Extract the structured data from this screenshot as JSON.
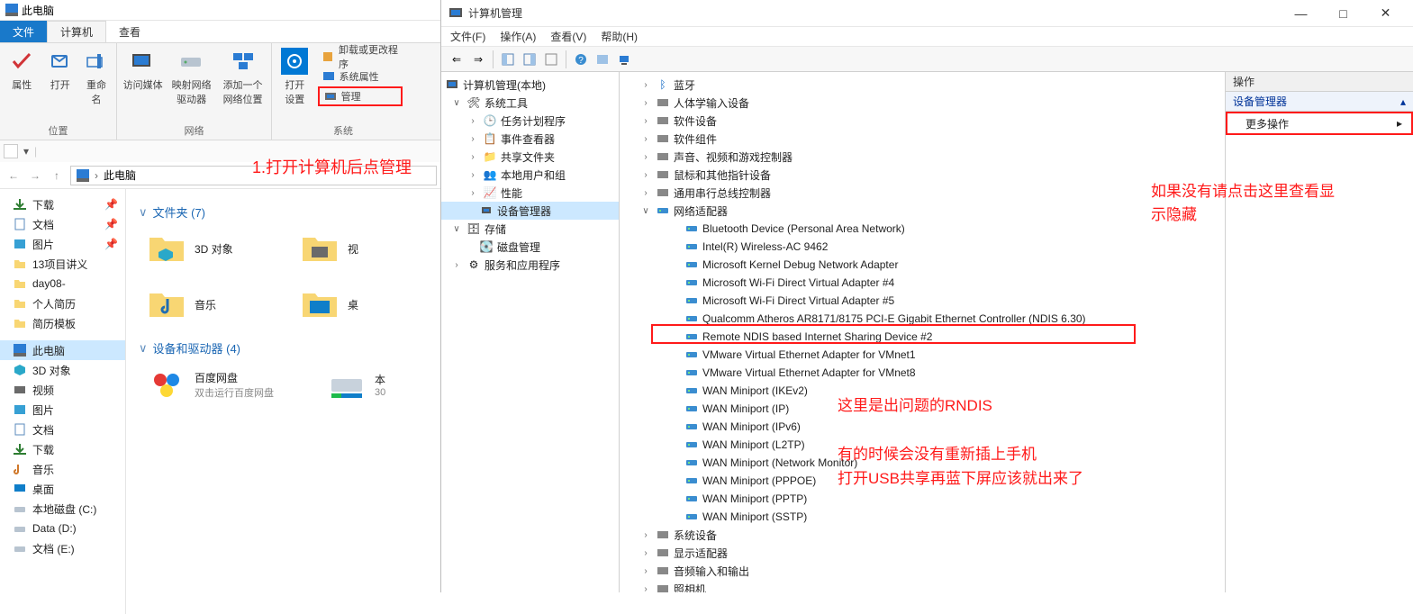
{
  "explorer": {
    "title": "此电脑",
    "tabs": {
      "file": "文件",
      "computer": "计算机",
      "view": "查看"
    },
    "ribbon": {
      "props": "属性",
      "open": "打开",
      "rename": "重命名",
      "access_media": "访问媒体",
      "map_drive": "映射网络\n驱动器",
      "add_loc": "添加一个\n网络位置",
      "open_settings": "打开\n设置",
      "uninstall": "卸载或更改程序",
      "sysprops": "系统属性",
      "manage": "管理",
      "grp_loc": "位置",
      "grp_net": "网络",
      "grp_sys": "系统"
    },
    "breadcrumb": {
      "root": "此电脑"
    },
    "sidebar": {
      "downloads": "下载",
      "docs": "文档",
      "pics": "图片",
      "proj13": "13项目讲义",
      "day08": "day08-",
      "resume": "个人简历",
      "tpl": "简历模板",
      "thispc": "此电脑",
      "obj3d": "3D 对象",
      "videos": "视频",
      "pics2": "图片",
      "docs2": "文档",
      "downloads2": "下载",
      "music": "音乐",
      "desktop": "桌面",
      "diskC": "本地磁盘 (C:)",
      "diskD": "Data (D:)",
      "diskE": "文档 (E:)"
    },
    "groups": {
      "folders_head": "文件夹 (7)",
      "devices_head": "设备和驱动器 (4)",
      "f_3d": "3D 对象",
      "f_video_partial": "视",
      "f_music": "音乐",
      "f_desktop_partial": "桌",
      "baidu": "百度网盘",
      "baidu_sub": "双击运行百度网盘",
      "local_partial": "本",
      "local_sub_partial": "30"
    },
    "annotation1": "1.打开计算机后点管理"
  },
  "cm": {
    "title": "计算机管理",
    "menu": {
      "file": "文件(F)",
      "action": "操作(A)",
      "view": "查看(V)",
      "help": "帮助(H)"
    },
    "left": {
      "root": "计算机管理(本地)",
      "systools": "系统工具",
      "tasks": "任务计划程序",
      "events": "事件查看器",
      "shared": "共享文件夹",
      "users": "本地用户和组",
      "perf": "性能",
      "devmgr": "设备管理器",
      "storage": "存储",
      "diskmgmt": "磁盘管理",
      "svc": "服务和应用程序"
    },
    "mid": {
      "bluetooth": "蓝牙",
      "hid": "人体学输入设备",
      "sw": "软件设备",
      "swcomp": "软件组件",
      "audio": "声音、视频和游戏控制器",
      "mouse": "鼠标和其他指针设备",
      "usb": "通用串行总线控制器",
      "netadapt": "网络适配器",
      "adapters": [
        "Bluetooth Device (Personal Area Network)",
        "Intel(R) Wireless-AC 9462",
        "Microsoft Kernel Debug Network Adapter",
        "Microsoft Wi-Fi Direct Virtual Adapter #4",
        "Microsoft Wi-Fi Direct Virtual Adapter #5",
        "Qualcomm Atheros AR8171/8175 PCI-E Gigabit Ethernet Controller (NDIS 6.30)",
        "Remote NDIS based Internet Sharing Device #2",
        "VMware Virtual Ethernet Adapter for VMnet1",
        "VMware Virtual Ethernet Adapter for VMnet8",
        "WAN Miniport (IKEv2)",
        "WAN Miniport (IP)",
        "WAN Miniport (IPv6)",
        "WAN Miniport (L2TP)",
        "WAN Miniport (Network Monitor)",
        "WAN Miniport (PPPOE)",
        "WAN Miniport (PPTP)",
        "WAN Miniport (SSTP)"
      ],
      "sysdev": "系统设备",
      "display": "显示适配器",
      "audioio": "音频输入和输出",
      "camera": "照相机"
    },
    "right": {
      "head": "操作",
      "section": "设备管理器",
      "more": "更多操作"
    },
    "ann_mid1": "这里是出问题的RNDIS",
    "ann_mid2": "有的时候会没有重新插上手机",
    "ann_mid3": "打开USB共享再蓝下屏应该就出来了",
    "ann_right": "如果没有请点击这里查看显示隐藏"
  },
  "watermark": ""
}
